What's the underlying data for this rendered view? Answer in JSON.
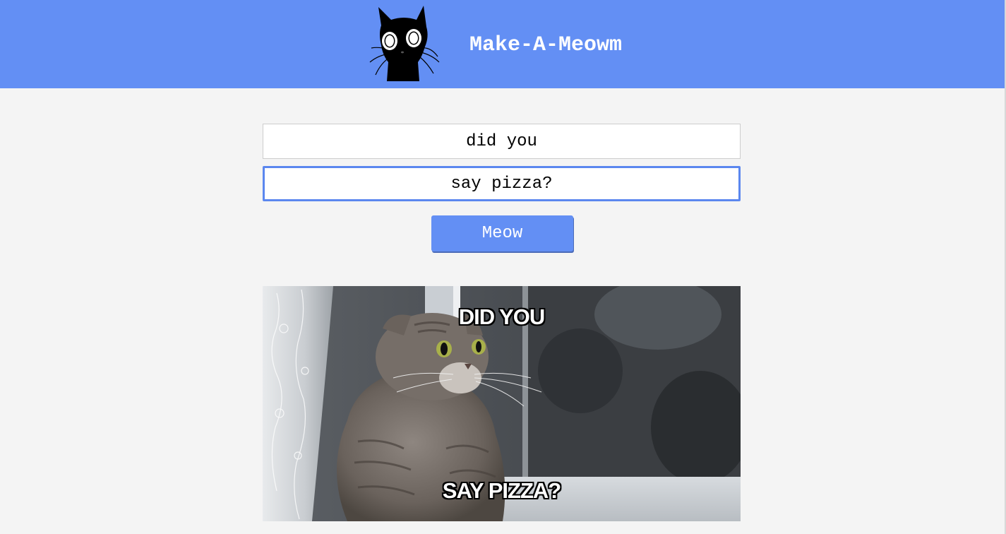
{
  "header": {
    "title": "Make-A-Meowm",
    "logo_icon": "black-cat-icon",
    "background_color": "#638ff4"
  },
  "form": {
    "top_text_value": "did you",
    "bottom_text_value": "say pizza?",
    "submit_label": "Meow"
  },
  "meme": {
    "top_caption": "DID YOU",
    "bottom_caption": "SAY PIZZA?",
    "image_subject": "grey-tabby-cat-photo"
  },
  "colors": {
    "accent": "#638ff4",
    "page_background": "#f4f4f4",
    "focus_border": "#5b87ef"
  }
}
